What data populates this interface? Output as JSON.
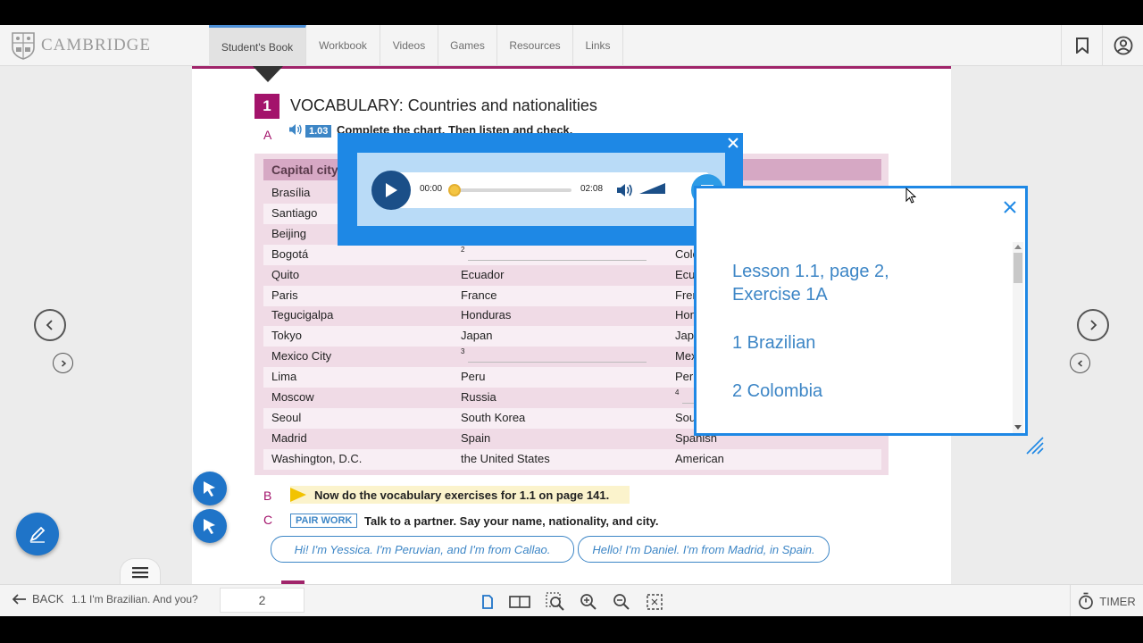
{
  "brand": {
    "name": "CAMBRIDGE"
  },
  "tabs": [
    {
      "label": "Student's Book",
      "active": true
    },
    {
      "label": "Workbook"
    },
    {
      "label": "Videos"
    },
    {
      "label": "Games"
    },
    {
      "label": "Resources"
    },
    {
      "label": "Links"
    }
  ],
  "header_icons": [
    "bookmark-icon",
    "user-icon"
  ],
  "section": {
    "number": "1",
    "title": "VOCABULARY: Countries and nationalities",
    "a_letter": "A",
    "audio_track": "1.03",
    "a_instruction": "Complete the chart. Then listen and check.",
    "table": {
      "header_col1": "Capital city",
      "header_col3": "y",
      "rows": [
        {
          "city": "Brasília",
          "country": "",
          "nationality": ""
        },
        {
          "city": "Santiago",
          "country": "",
          "nationality": ""
        },
        {
          "city": "Beijing",
          "country": "",
          "nationality": ""
        },
        {
          "city": "Bogotá",
          "country": "2",
          "nationality": "Colo"
        },
        {
          "city": "Quito",
          "country": "Ecuador",
          "nationality": "Ecu"
        },
        {
          "city": "Paris",
          "country": "France",
          "nationality": "Fren"
        },
        {
          "city": "Tegucigalpa",
          "country": "Honduras",
          "nationality": "Hon"
        },
        {
          "city": "Tokyo",
          "country": "Japan",
          "nationality": "Jap"
        },
        {
          "city": "Mexico City",
          "country": "3",
          "nationality": "Mex"
        },
        {
          "city": "Lima",
          "country": "Peru",
          "nationality": "Peru"
        },
        {
          "city": "Moscow",
          "country": "Russia",
          "nationality": "4"
        },
        {
          "city": "Seoul",
          "country": "South Korea",
          "nationality": "Sou"
        },
        {
          "city": "Madrid",
          "country": "Spain",
          "nationality": "Spanish"
        },
        {
          "city": "Washington, D.C.",
          "country": "the United States",
          "nationality": "American"
        }
      ]
    },
    "b_letter": "B",
    "b_text": "Now do the vocabulary exercises for 1.1 on page 141.",
    "c_letter": "C",
    "pair_work": "PAIR WORK",
    "c_text": "Talk to a partner. Say your name, nationality, and city.",
    "bubble1": "Hi! I'm Yessica. I'm Peruvian, and I'm from Callao.",
    "bubble2": "Hello! I'm Daniel. I'm from Madrid, in Spain."
  },
  "audio_player": {
    "current_time": "00:00",
    "total_time": "02:08",
    "progress": 0
  },
  "transcript": {
    "heading": "Lesson 1.1, page 2, Exercise 1A",
    "line1": "1 Brazilian",
    "line2": "2 Colombia"
  },
  "bottom_bar": {
    "back_label": "BACK",
    "lesson_title": "1.1 I'm Brazilian. And you?",
    "page_number": "2",
    "timer_label": "TIMER",
    "tool_icons": [
      "single-page-icon",
      "double-page-icon",
      "zoom-area-icon",
      "zoom-in-icon",
      "zoom-out-icon",
      "fit-screen-icon"
    ]
  },
  "colors": {
    "accent_blue": "#1e88e5",
    "magenta": "#a3136b",
    "table_pink": "#f0dbe6",
    "transcript_text": "#3d86c6"
  }
}
